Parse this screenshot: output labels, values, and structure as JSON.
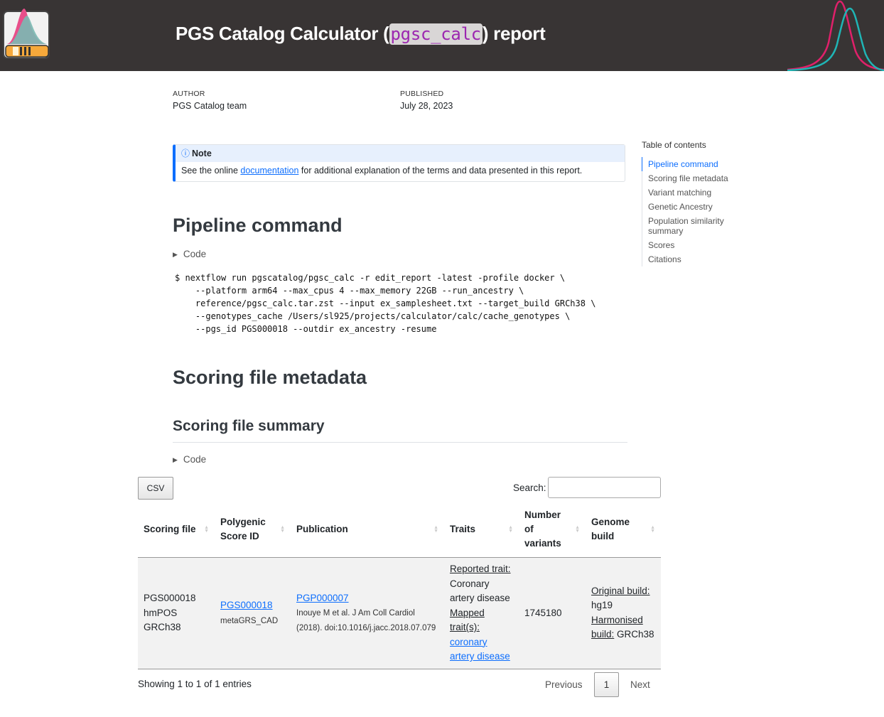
{
  "header": {
    "title_prefix": "PGS Catalog Calculator (",
    "title_code": "pgsc_calc",
    "title_suffix": ") report",
    "bg_color": "#383434",
    "curve_colors": [
      "#e0206a",
      "#1fb5b5"
    ]
  },
  "meta": {
    "author_label": "AUTHOR",
    "author": "PGS Catalog team",
    "published_label": "PUBLISHED",
    "published": "July 28, 2023"
  },
  "note": {
    "icon": "info-icon",
    "title": "Note",
    "text_before": "See the online ",
    "link": "documentation",
    "text_after": " for additional explanation of the terms and data presented in this report."
  },
  "toc": {
    "title": "Table of contents",
    "items": [
      "Pipeline command",
      "Scoring file metadata",
      "Variant matching",
      "Genetic Ancestry",
      "Population similarity summary",
      "Scores",
      "Citations"
    ]
  },
  "sections": {
    "pipeline": "Pipeline command",
    "scoring_metadata": "Scoring file metadata",
    "scoring_summary": "Scoring file summary",
    "code_toggle": "Code"
  },
  "command": "$ nextflow run pgscatalog/pgsc_calc -r edit_report -latest -profile docker \\\n    --platform arm64 --max_cpus 4 --max_memory 22GB --run_ancestry \\\n    reference/pgsc_calc.tar.zst --input ex_samplesheet.txt --target_build GRCh38 \\\n    --genotypes_cache /Users/sl925/projects/calculator/calc/cache_genotypes \\\n    --pgs_id PGS000018 --outdir ex_ancestry -resume",
  "table": {
    "csv_label": "CSV",
    "search_label": "Search:",
    "search_value": "",
    "columns": [
      "Scoring file",
      "Polygenic Score ID",
      "Publication",
      "Traits",
      "Number of variants",
      "Genome build"
    ],
    "row": {
      "scoring_file": "PGS000018 hmPOS GRCh38",
      "pgs_id": "PGS000018",
      "pgs_name": "metaGRS_CAD",
      "pub_id": "PGP000007",
      "pub_citation": "Inouye M et al. J Am Coll Cardiol (2018). doi:10.1016/j.jacc.2018.07.079",
      "reported_label": "Reported trait:",
      "reported_trait": "Coronary artery disease",
      "mapped_label": "Mapped trait(s):",
      "mapped_trait": "coronary artery disease",
      "variants": "1745180",
      "orig_build_label": "Original build:",
      "orig_build": "hg19",
      "harm_build_label": "Harmonised build:",
      "harm_build": "GRCh38"
    },
    "info": "Showing 1 to 1 of 1 entries",
    "prev": "Previous",
    "page": "1",
    "next": "Next"
  }
}
